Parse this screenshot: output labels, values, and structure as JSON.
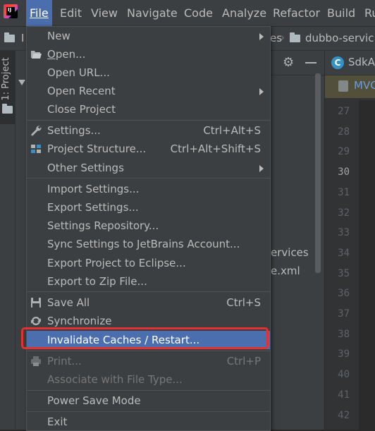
{
  "menubar": {
    "items": [
      {
        "label": "File",
        "active": true
      },
      {
        "label": "Edit"
      },
      {
        "label": "View"
      },
      {
        "label": "Navigate"
      },
      {
        "label": "Code"
      },
      {
        "label": "Analyze"
      },
      {
        "label": "Refactor"
      },
      {
        "label": "Build"
      },
      {
        "label": "Ru"
      }
    ]
  },
  "navbar": {
    "crumb_left": "I",
    "crumb_mid": "es",
    "crumb_right": "dubbo-servic"
  },
  "tool_window": {
    "project_tab": "1: Project",
    "tree_partial_1": "ervices",
    "tree_partial_2": "e.xml"
  },
  "editor": {
    "tab_label": "SdkA",
    "breadcrumb": "MVC",
    "line_numbers": [
      "27",
      "28",
      "29",
      "30",
      "31",
      "32",
      "33",
      "34",
      "35",
      "36",
      "37",
      "38",
      "39",
      "40",
      "41",
      "42"
    ],
    "current_line": "30"
  },
  "file_menu": {
    "new": "New",
    "open": "Open...",
    "open_url": "Open URL...",
    "open_recent": "Open Recent",
    "close_project": "Close Project",
    "settings": "Settings...",
    "settings_shortcut": "Ctrl+Alt+S",
    "project_structure": "Project Structure...",
    "project_structure_shortcut": "Ctrl+Alt+Shift+S",
    "other_settings": "Other Settings",
    "import_settings": "Import Settings...",
    "export_settings": "Export Settings...",
    "settings_repository": "Settings Repository...",
    "sync_settings": "Sync Settings to JetBrains Account...",
    "export_eclipse": "Export Project to Eclipse...",
    "export_zip": "Export to Zip File...",
    "save_all": "Save All",
    "save_all_shortcut": "Ctrl+S",
    "synchronize": "Synchronize",
    "invalidate_caches": "Invalidate Caches / Restart...",
    "print": "Print...",
    "print_shortcut": "Ctrl+P",
    "associate_file_type": "Associate with File Type...",
    "power_save": "Power Save Mode",
    "exit": "Exit"
  },
  "colors": {
    "highlight": "#4b6eaf",
    "annotation_box": "#e53030",
    "menu_bg": "#3c3f41"
  }
}
